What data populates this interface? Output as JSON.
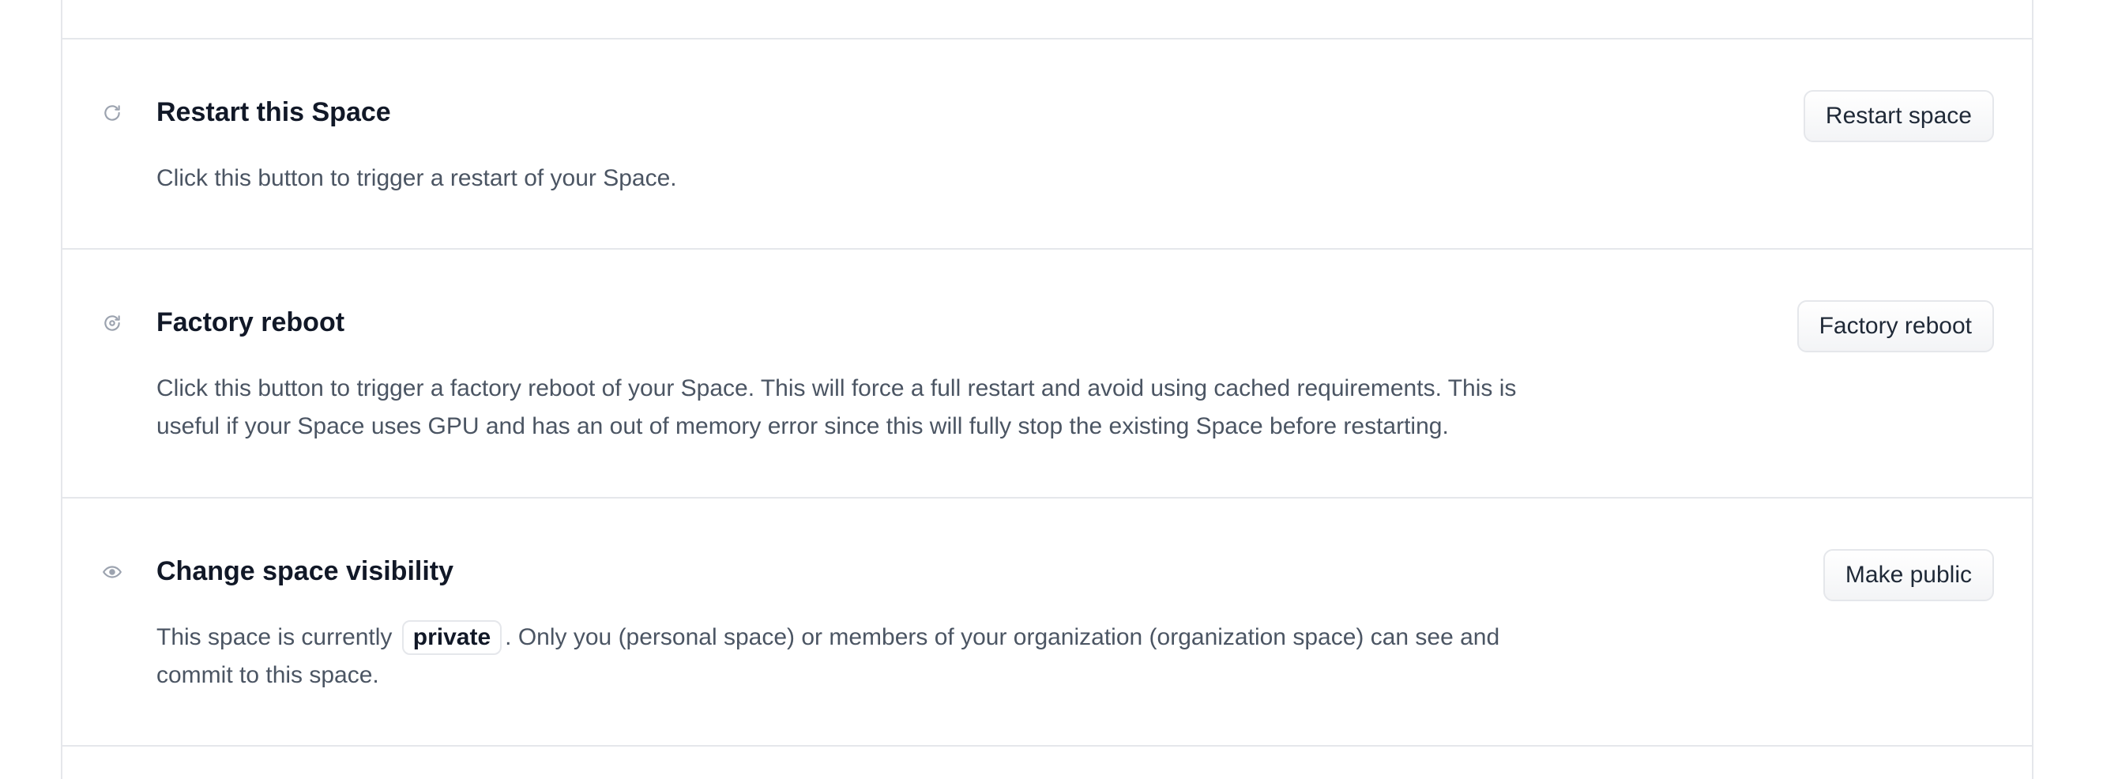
{
  "sections": {
    "restart": {
      "icon": "restart-icon",
      "title": "Restart this Space",
      "description": "Click this button to trigger a restart of your Space.",
      "button_label": "Restart space"
    },
    "factory_reboot": {
      "icon": "factory-reboot-icon",
      "title": "Factory reboot",
      "description": "Click this button to trigger a factory reboot of your Space. This will force a full restart and avoid using cached requirements. This is useful if your Space uses GPU and has an out of memory error since this will fully stop the existing Space before restarting.",
      "button_label": "Factory reboot"
    },
    "visibility": {
      "icon": "eye-icon",
      "title": "Change space visibility",
      "description_prefix": "This space is currently",
      "visibility_badge": "private",
      "description_suffix": ". Only you (personal space) or members of your organization (organization space) can see and commit to this space.",
      "button_label": "Make public"
    }
  }
}
